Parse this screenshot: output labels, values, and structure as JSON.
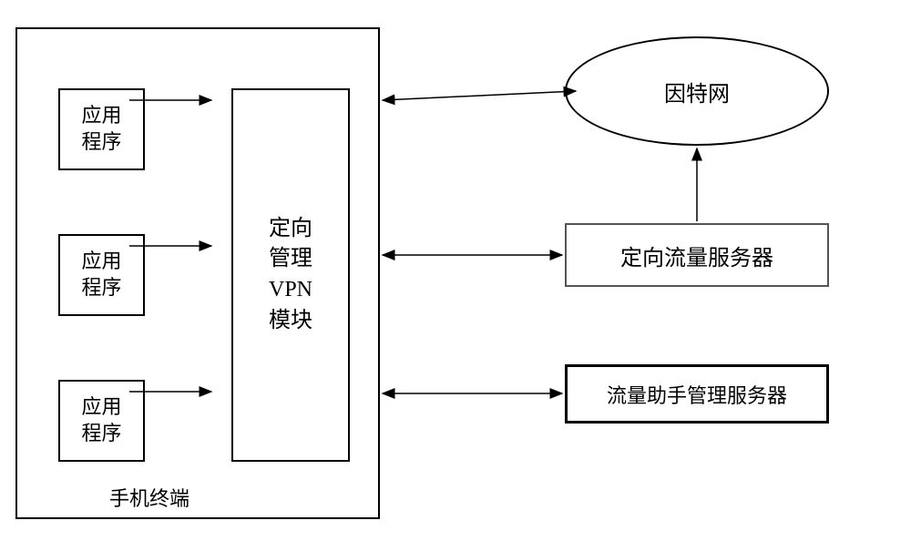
{
  "phone": {
    "label": "手机终端",
    "apps": {
      "app1": "应用\n程序",
      "app2": "应用\n程序",
      "app3": "应用\n程序"
    },
    "vpn_module": "定向\n管理\nVPN\n模块"
  },
  "internet": "因特网",
  "traffic_server": "定向流量服务器",
  "assistant_server": "流量助手管理服务器"
}
